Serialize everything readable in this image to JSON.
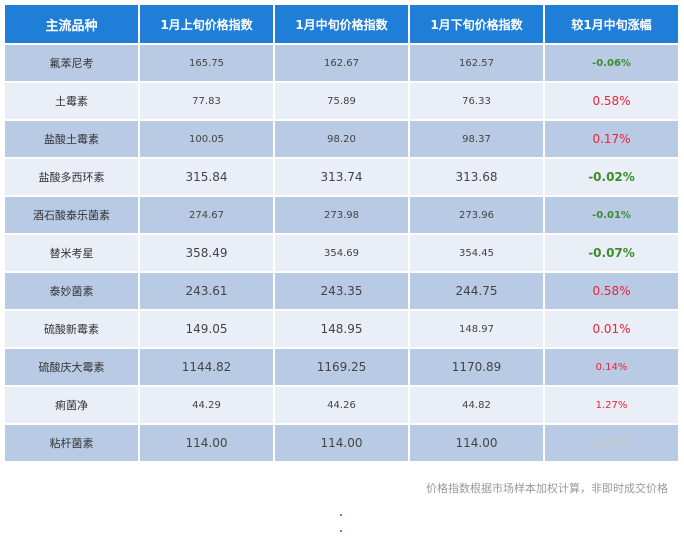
{
  "table": {
    "headers": [
      "主流品种",
      "1月上旬价格指数",
      "1月中旬价格指数",
      "1月下旬价格指数",
      "较1月中旬涨幅"
    ],
    "rows": [
      [
        "氟苯尼考",
        "165.75",
        "162.67",
        "162.57",
        "-0.06%"
      ],
      [
        "土霉素",
        "77.83",
        "75.89",
        "76.33",
        "0.58%"
      ],
      [
        "盐酸土霉素",
        "100.05",
        "98.20",
        "98.37",
        "0.17%"
      ],
      [
        "盐酸多西环素",
        "315.84",
        "313.74",
        "313.68",
        "-0.02%"
      ],
      [
        "酒石酸泰乐菌素",
        "274.67",
        "273.98",
        "273.96",
        "-0.01%"
      ],
      [
        "替米考星",
        "358.49",
        "354.69",
        "354.45",
        "-0.07%"
      ],
      [
        "泰妙菌素",
        "243.61",
        "243.35",
        "244.75",
        "0.58%"
      ],
      [
        "硫酸新霉素",
        "149.05",
        "148.95",
        "148.97",
        "0.01%"
      ],
      [
        "硫酸庆大霉素",
        "1144.82",
        "1169.25",
        "1170.89",
        "0.14%"
      ],
      [
        "痢菌净",
        "44.29",
        "44.26",
        "44.82",
        "1.27%"
      ],
      [
        "粘杆菌素",
        "114.00",
        "114.00",
        "114.00",
        "0.00%"
      ]
    ]
  },
  "note": "价格指数根据市场样本加权计算，非即时成交价格",
  "colors": {
    "header": "#1f7ed8",
    "row_dark": "#b9cae5",
    "row_light": "#eaeef7",
    "up": "#e8233a",
    "down": "#3c8c2a",
    "flat": "#c9c9c9"
  }
}
